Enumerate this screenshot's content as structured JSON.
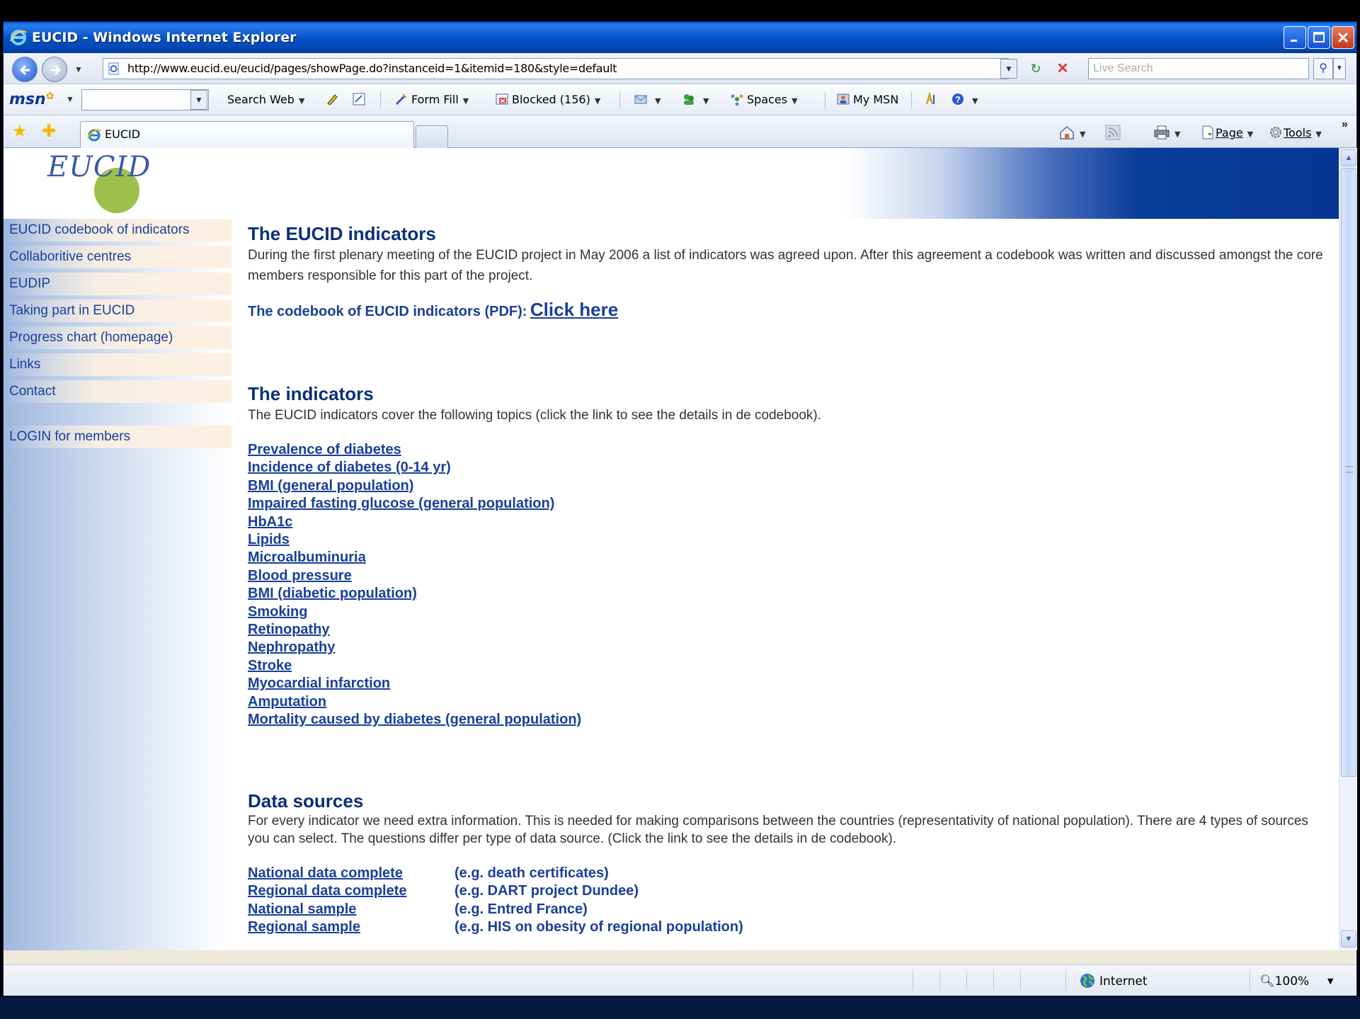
{
  "window": {
    "title": "EUCID - Windows Internet Explorer"
  },
  "address_bar": {
    "url": "http://www.eucid.eu/eucid/pages/showPage.do?instanceid=1&itemid=180&style=default",
    "search_placeholder": "Live Search"
  },
  "msn_toolbar": {
    "logo": "msn",
    "search_web": "Search Web",
    "form_fill": "Form Fill",
    "blocked": "Blocked (156)",
    "spaces": "Spaces",
    "my_msn": "My MSN"
  },
  "tabs": {
    "active_tab": "EUCID"
  },
  "command_bar": {
    "page": "Page",
    "tools": "Tools"
  },
  "site": {
    "logo_text": "EUCID",
    "menu": [
      "EUCID codebook of indicators",
      "Collaboritive centres",
      "EUDIP",
      "Taking part in EUCID",
      "Progress chart (homepage)",
      "Links",
      "Contact"
    ],
    "login": "LOGIN for members"
  },
  "content": {
    "section1": {
      "heading": "The EUCID indicators",
      "paragraph": "During the first plenary meeting of the EUCID project in May 2006 a list of indicators was agreed upon. After this agreement a codebook was written and discussed amongst the core members responsible for this part of the project.",
      "codebook_label": "The codebook of EUCID indicators (PDF):",
      "codebook_link": "Click here"
    },
    "section2": {
      "heading": "The indicators",
      "paragraph": "The EUCID indicators cover the following topics (click the link to see the details in de codebook).",
      "links": [
        "Prevalence of diabetes",
        "Incidence of diabetes (0-14 yr)",
        "BMI (general population)",
        "Impaired fasting glucose (general population)",
        "HbA1c",
        "Lipids",
        "Microalbuminuria",
        "Blood pressure",
        "BMI (diabetic population)",
        "Smoking",
        "Retinopathy",
        "Nephropathy",
        "Stroke",
        "Myocardial infarction",
        "Amputation",
        "Mortality caused by diabetes (general population)"
      ]
    },
    "section3": {
      "heading": "Data sources",
      "paragraph": "For every indicator we need extra information. This is needed for making comparisons between the countries (representativity of national population). There are 4 types of sources you can select. The questions differ per type of data source. (Click the link to see the details in de codebook).",
      "sources": [
        {
          "link": "National data complete",
          "example": "(e.g. death certificates)"
        },
        {
          "link": "Regional data complete",
          "example": "(e.g. DART project Dundee)"
        },
        {
          "link": "National sample",
          "example": "(e.g. Entred France)"
        },
        {
          "link": "Regional sample",
          "example": "(e.g. HIS on obesity of regional population)"
        }
      ]
    }
  },
  "status_bar": {
    "zone": "Internet",
    "zoom": "100%"
  },
  "colors": {
    "link": "#1a3f9a",
    "heading": "#0b2f7a",
    "header_blue": "#063693",
    "logo_green": "#9cc04a",
    "menu_bg": "#fdf0e1"
  },
  "icons": {
    "browser": "ie-logo-icon",
    "back": "back-arrow-icon",
    "forward": "forward-arrow-icon",
    "refresh": "refresh-icon",
    "stop": "stop-icon",
    "search": "search-icon",
    "favorites": "favorites-star-icon",
    "home": "home-icon",
    "feeds": "feed-icon",
    "print": "printer-icon",
    "globe": "globe-icon",
    "zoom": "zoom-icon"
  }
}
